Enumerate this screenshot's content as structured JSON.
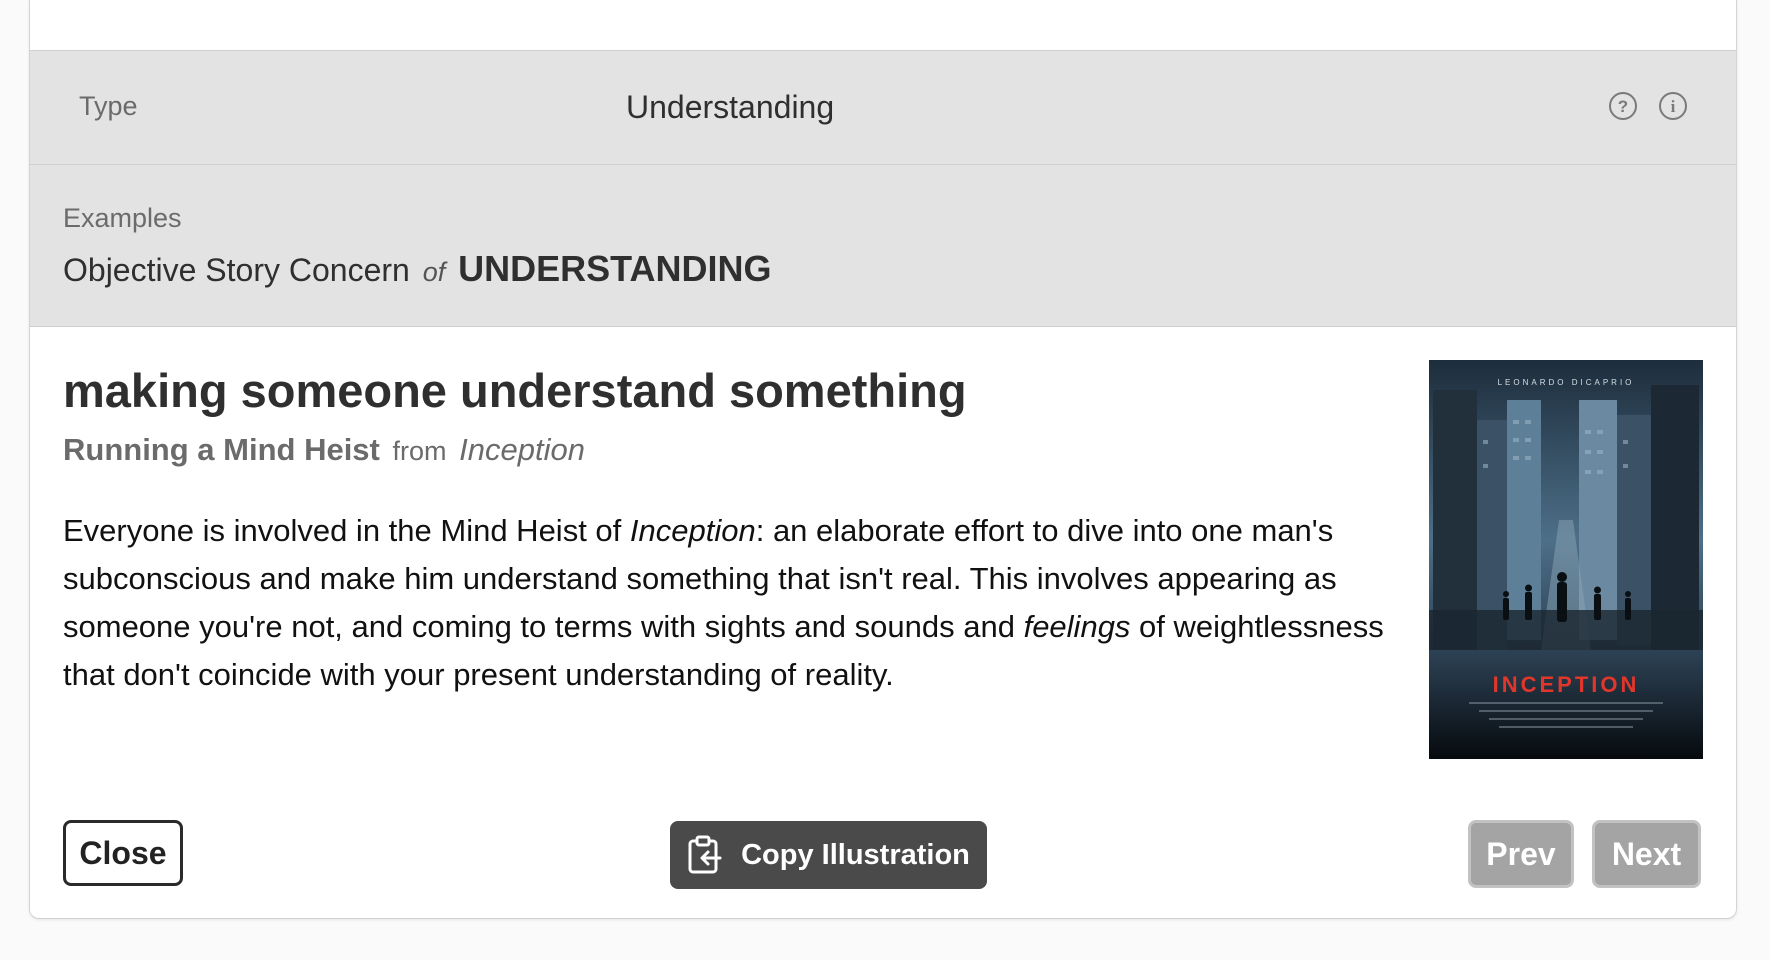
{
  "type_row": {
    "label": "Type",
    "value": "Understanding",
    "icons": [
      "question-circle-icon",
      "info-circle-icon"
    ]
  },
  "examples": {
    "label": "Examples",
    "prefix": "Objective Story Concern",
    "connector": "of",
    "concern": "UNDERSTANDING"
  },
  "illustration": {
    "heading": "making someone understand something",
    "example_title": "Running a Mind Heist",
    "from_word": "from",
    "film": "Inception",
    "body": {
      "p1": "Everyone is involved in the Mind Heist of ",
      "film_italic": "Inception",
      "p2": ": an elaborate effort to dive into one man's subconscious and make him understand something that isn't real. This involves appearing as someone you're not, and coming to terms with sights and sounds and ",
      "feelings_italic": "feelings",
      "p3": " of weightlessness that don't coincide with your present understanding of reality."
    },
    "poster": {
      "actor": "LEONARDO DICAPRIO",
      "title": "INCEPTION",
      "alt": "Inception movie poster"
    }
  },
  "buttons": {
    "close": "Close",
    "copy": "Copy Illustration",
    "prev": "Prev",
    "next": "Next"
  },
  "colors": {
    "section_bg": "#e3e3e3",
    "copy_button_bg": "#4a4a4a",
    "nav_button_bg": "#a4a4a4",
    "poster_title_red": "#e0362b"
  }
}
